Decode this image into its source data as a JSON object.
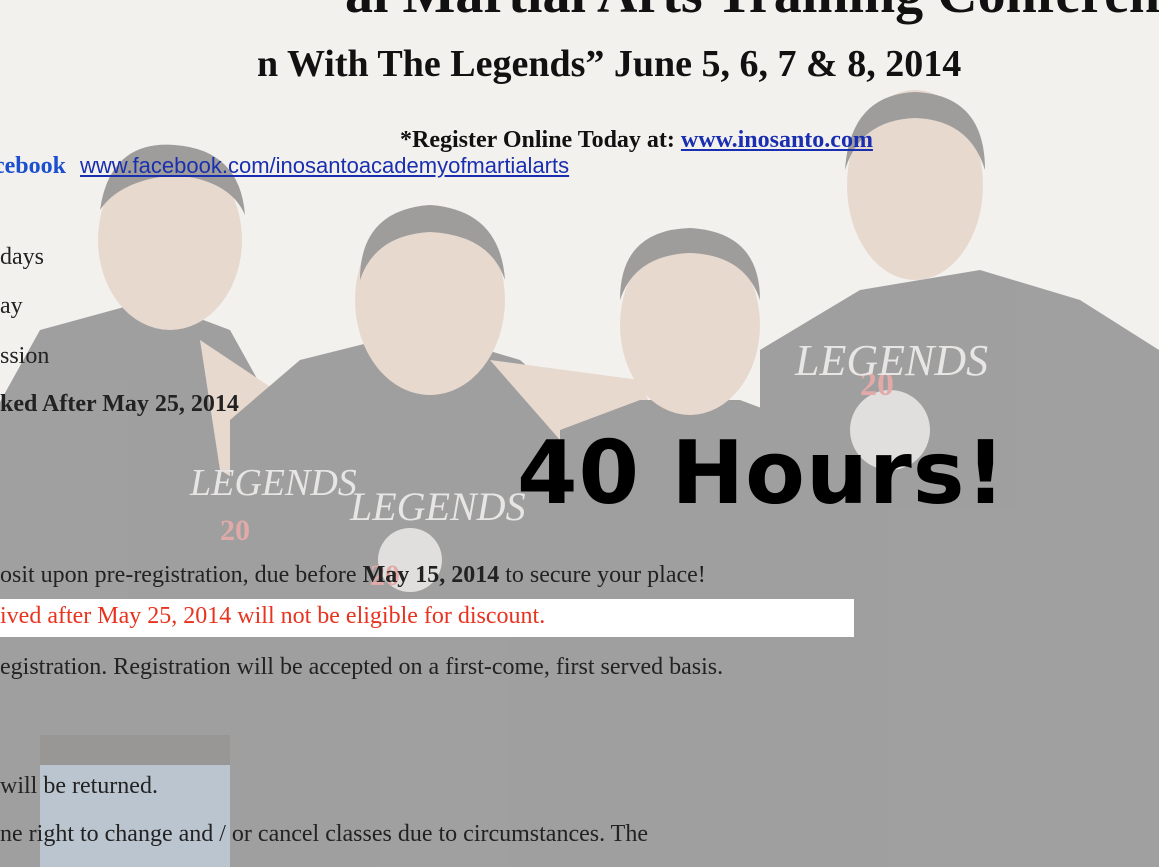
{
  "header": {
    "title": "al Martial Arts Training Conference",
    "subtitle": "n With The Legends” June 5, 6, 7 & 8, 2014",
    "register_prefix": "*Register Online Today at: ",
    "register_link": "www.inosanto.com",
    "facebook_label": "cebook",
    "facebook_link": "www.facebook.com/inosantoacademyofmartialarts"
  },
  "pricing_lines": [
    "days",
    "ay",
    "ssion",
    "ked After May 25, 2014"
  ],
  "callout": "40 Hours!",
  "paragraph": {
    "deposit_prefix": "osit upon pre-registration, due before ",
    "deposit_date": "May 15, 2014",
    "deposit_suffix": " to secure your place!",
    "discount_notice": "ived after May 25, 2014  will not be eligible for discount.",
    "first_come": "egistration. Registration will be accepted on a first-come, first served basis.",
    "returned": " will be returned.",
    "rights": "ne right to change and / or cancel classes due to circumstances. The"
  },
  "photo": {
    "shirt_text": "LEGENDS",
    "shirt_year": "20",
    "colors": {
      "shirt": "#2f3034",
      "skin": "#d9b9a6",
      "jeans": "#6f8ba8",
      "accent_red": "#c94b4b"
    }
  },
  "colors": {
    "link_blue": "#1a2fb0",
    "facebook_blue": "#1b4fcf",
    "red_notice": "#e8331f",
    "callout": "#000000"
  }
}
